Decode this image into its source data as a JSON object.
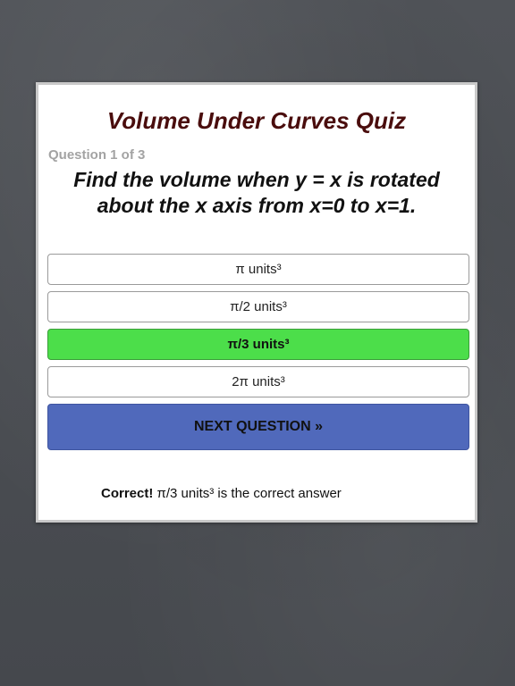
{
  "quiz": {
    "title": "Volume Under Curves Quiz",
    "counter": "Question 1 of 3",
    "question_line1": "Find the volume when y = x is rotated",
    "question_line2": "about the x axis from x=0 to x=1.",
    "answers": [
      {
        "label": "π units³",
        "state": "default"
      },
      {
        "label": "π/2 units³",
        "state": "default"
      },
      {
        "label": "π/3 units³",
        "state": "correct"
      },
      {
        "label": "2π units³",
        "state": "default"
      }
    ],
    "next_label": "NEXT QUESTION »",
    "feedback": {
      "status": "Correct!",
      "message": " π/3 units³ is the correct answer"
    }
  },
  "colors": {
    "background": "#4b4e53",
    "card": "#ffffff",
    "title": "#4a0d0d",
    "counter": "#a3a3a3",
    "correct_answer": "#4cde4a",
    "next_button": "#5069bb"
  }
}
